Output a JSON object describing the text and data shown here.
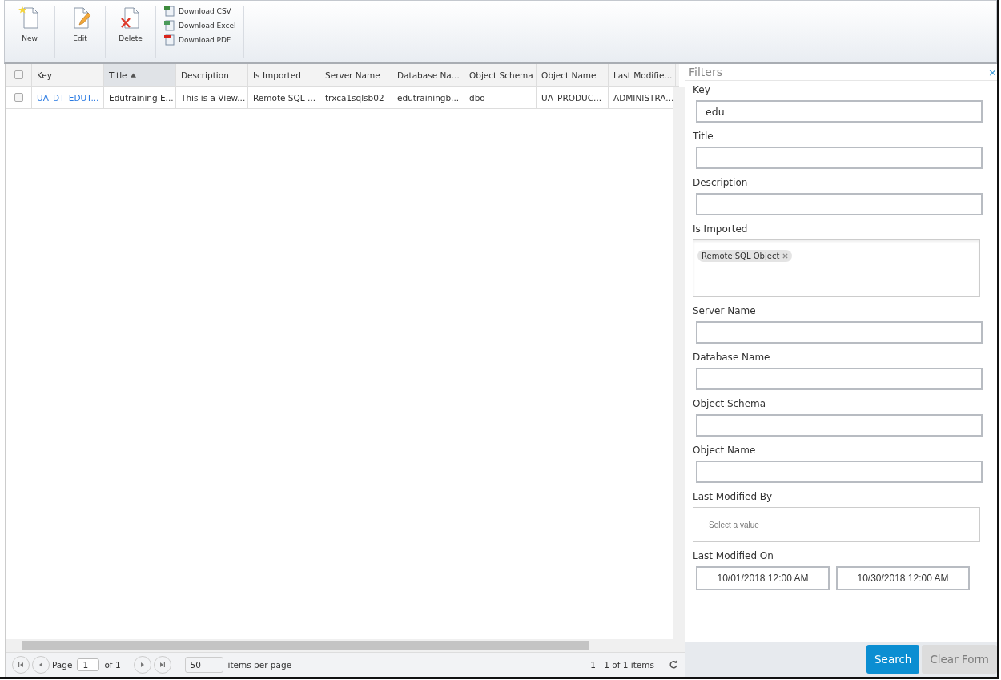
{
  "toolbar": {
    "big_buttons": [
      {
        "label": "New",
        "kind": "new"
      },
      {
        "label": "Edit",
        "kind": "edit"
      },
      {
        "label": "Delete",
        "kind": "delete"
      }
    ],
    "downloads": [
      {
        "label": "Download CSV",
        "kind": "csv"
      },
      {
        "label": "Download Excel",
        "kind": "excel"
      },
      {
        "label": "Download PDF",
        "kind": "pdf"
      }
    ]
  },
  "table": {
    "select_all_checked": false,
    "columns": [
      {
        "label": "Key",
        "sorted": false
      },
      {
        "label": "Title",
        "sorted": true
      },
      {
        "label": "Description",
        "sorted": false
      },
      {
        "label": "Is Imported",
        "sorted": false
      },
      {
        "label": "Server Name",
        "sorted": false
      },
      {
        "label": "Database Na...",
        "sorted": false
      },
      {
        "label": "Object Schema",
        "sorted": false
      },
      {
        "label": "Object Name",
        "sorted": false
      },
      {
        "label": "Last Modifie...",
        "sorted": false
      }
    ],
    "rows": [
      {
        "checked": false,
        "cells": [
          "UA_DT_EDUT...",
          "Edutraining E...",
          "This is a View...",
          "Remote SQL ...",
          "trxca1sqlsb02",
          "edutrainingb...",
          "dbo",
          "UA_PRODUC...",
          "ADMINISTRA..."
        ]
      }
    ]
  },
  "pager": {
    "page_label": "Page",
    "page": "1",
    "of": "of 1",
    "page_size": "50",
    "per_page_label": "items per page",
    "summary": "1 - 1 of 1 items"
  },
  "filters": {
    "title": "Filters",
    "close": "×",
    "fields": [
      {
        "kind": "text",
        "label": "Key",
        "value": "edu"
      },
      {
        "kind": "text",
        "label": "Title"
      },
      {
        "kind": "text",
        "label": "Description"
      },
      {
        "kind": "tags",
        "label": "Is Imported",
        "tags": [
          "Remote SQL Object"
        ]
      },
      {
        "kind": "text",
        "label": "Server Name"
      },
      {
        "kind": "text",
        "label": "Database Name"
      },
      {
        "kind": "text",
        "label": "Object Schema"
      },
      {
        "kind": "text",
        "label": "Object Name"
      },
      {
        "kind": "select",
        "label": "Last Modified By",
        "placeholder": "Select a value"
      },
      {
        "kind": "daterange",
        "label": "Last Modified On",
        "from": "10/01/2018 12:00 AM",
        "to": "10/30/2018 12:00 AM"
      }
    ],
    "buttons": [
      {
        "label": "Search",
        "disabled": false
      },
      {
        "label": "Clear Form",
        "disabled": true
      }
    ]
  }
}
